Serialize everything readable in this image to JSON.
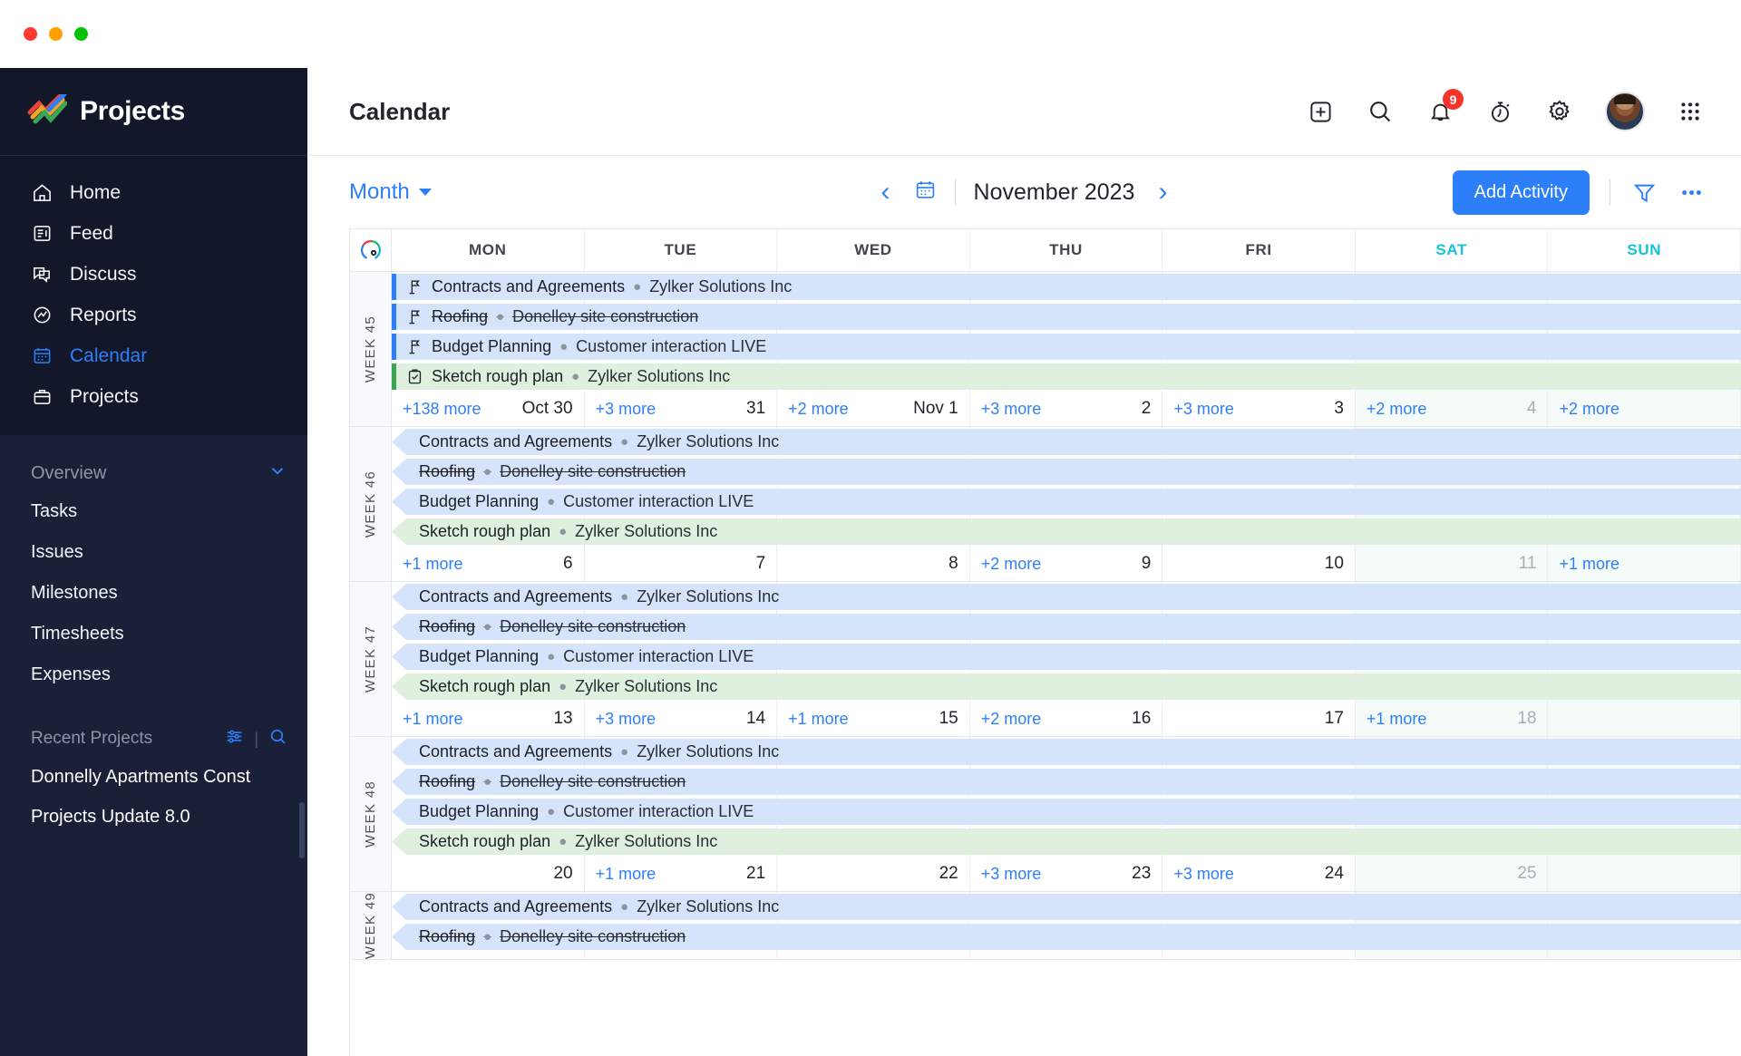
{
  "window": {
    "traffic_lights": [
      "close",
      "minimize",
      "maximize"
    ]
  },
  "sidebar": {
    "brand": "Projects",
    "nav_items": [
      {
        "label": "Home",
        "icon": "home-icon",
        "active": false
      },
      {
        "label": "Feed",
        "icon": "feed-icon",
        "active": false
      },
      {
        "label": "Discuss",
        "icon": "discuss-icon",
        "active": false
      },
      {
        "label": "Reports",
        "icon": "reports-icon",
        "active": false
      },
      {
        "label": "Calendar",
        "icon": "calendar-icon",
        "active": true
      },
      {
        "label": "Projects",
        "icon": "briefcase-icon",
        "active": false
      }
    ],
    "overview_label": "Overview",
    "module_items": [
      {
        "label": "Tasks"
      },
      {
        "label": "Issues"
      },
      {
        "label": "Milestones"
      },
      {
        "label": "Timesheets"
      },
      {
        "label": "Expenses"
      }
    ],
    "recent_label": "Recent Projects",
    "recent_separator": "|",
    "recent_items": [
      {
        "label": "Donnelly Apartments Const"
      },
      {
        "label": "Projects Update 8.0"
      }
    ]
  },
  "header": {
    "page_title": "Calendar",
    "actions": [
      {
        "name": "add-box-icon"
      },
      {
        "name": "search-icon"
      },
      {
        "name": "notifications-icon",
        "badge": "9"
      },
      {
        "name": "timer-icon"
      },
      {
        "name": "settings-icon"
      },
      {
        "name": "avatar"
      },
      {
        "name": "apps-grid-icon"
      }
    ],
    "notification_count": "9"
  },
  "toolbar": {
    "view_label": "Month",
    "prev_label": "‹",
    "next_label": "›",
    "current_period": "November 2023",
    "add_activity_label": "Add Activity",
    "filter_icon": "filter-icon",
    "more_icon": "more-options-icon",
    "datepicker_icon": "calendar-picker-icon"
  },
  "calendar": {
    "corner_icon": "calendar-settings-icon",
    "day_headers": [
      {
        "label": "MON",
        "weekend": false
      },
      {
        "label": "TUE",
        "weekend": false
      },
      {
        "label": "WED",
        "weekend": false
      },
      {
        "label": "THU",
        "weekend": false
      },
      {
        "label": "FRI",
        "weekend": false
      },
      {
        "label": "SAT",
        "weekend": true
      },
      {
        "label": "SUN",
        "weekend": true
      }
    ],
    "weeks": [
      {
        "label": "WEEK 45",
        "events": [
          {
            "title": "Contracts and Agreements",
            "project": "Zylker Solutions Inc",
            "color": "blue",
            "icon": "milestone-flag-icon",
            "start": true,
            "strike": false,
            "span": 7
          },
          {
            "title": "Roofing",
            "project": "Donelley site construction",
            "color": "blue",
            "icon": "milestone-flag-icon",
            "start": true,
            "strike": true,
            "span": 7
          },
          {
            "title": "Budget Planning",
            "project": "Customer interaction LIVE",
            "color": "blue",
            "icon": "milestone-flag-icon",
            "start": true,
            "strike": false,
            "span": 7
          },
          {
            "title": "Sketch rough plan",
            "project": "Zylker Solutions Inc",
            "color": "green",
            "icon": "task-clipboard-icon",
            "start": true,
            "strike": false,
            "span": 7
          }
        ],
        "days": [
          {
            "more": "+138 more",
            "date": "Oct 30",
            "weekend": false
          },
          {
            "more": "+3 more",
            "date": "31",
            "weekend": false
          },
          {
            "more": "+2 more",
            "date": "Nov 1",
            "weekend": false
          },
          {
            "more": "+3 more",
            "date": "2",
            "weekend": false
          },
          {
            "more": "+3 more",
            "date": "3",
            "weekend": false
          },
          {
            "more": "+2 more",
            "date": "4",
            "weekend": true
          },
          {
            "more": "+2 more",
            "date": "",
            "weekend": true
          }
        ]
      },
      {
        "label": "WEEK 46",
        "events": [
          {
            "title": "Contracts and Agreements",
            "project": "Zylker Solutions Inc",
            "color": "blue",
            "icon": "",
            "start": false,
            "strike": false,
            "span": 7
          },
          {
            "title": "Roofing",
            "project": "Donelley site construction",
            "color": "blue",
            "icon": "",
            "start": false,
            "strike": true,
            "span": 7
          },
          {
            "title": "Budget Planning",
            "project": "Customer interaction LIVE",
            "color": "blue",
            "icon": "",
            "start": false,
            "strike": false,
            "span": 7
          },
          {
            "title": "Sketch rough plan",
            "project": "Zylker Solutions Inc",
            "color": "green",
            "icon": "",
            "start": false,
            "strike": false,
            "span": 7
          }
        ],
        "days": [
          {
            "more": "+1 more",
            "date": "6",
            "weekend": false
          },
          {
            "more": "",
            "date": "7",
            "weekend": false
          },
          {
            "more": "",
            "date": "8",
            "weekend": false
          },
          {
            "more": "+2 more",
            "date": "9",
            "weekend": false
          },
          {
            "more": "",
            "date": "10",
            "weekend": false
          },
          {
            "more": "",
            "date": "11",
            "weekend": true
          },
          {
            "more": "+1 more",
            "date": "",
            "weekend": true
          }
        ]
      },
      {
        "label": "WEEK 47",
        "events": [
          {
            "title": "Contracts and Agreements",
            "project": "Zylker Solutions Inc",
            "color": "blue",
            "icon": "",
            "start": false,
            "strike": false,
            "span": 7
          },
          {
            "title": "Roofing",
            "project": "Donelley site construction",
            "color": "blue",
            "icon": "",
            "start": false,
            "strike": true,
            "span": 7
          },
          {
            "title": "Budget Planning",
            "project": "Customer interaction LIVE",
            "color": "blue",
            "icon": "",
            "start": false,
            "strike": false,
            "span": 7
          },
          {
            "title": "Sketch rough plan",
            "project": "Zylker Solutions Inc",
            "color": "green",
            "icon": "",
            "start": false,
            "strike": false,
            "span": 7
          }
        ],
        "days": [
          {
            "more": "+1 more",
            "date": "13",
            "weekend": false
          },
          {
            "more": "+3 more",
            "date": "14",
            "weekend": false
          },
          {
            "more": "+1 more",
            "date": "15",
            "weekend": false
          },
          {
            "more": "+2 more",
            "date": "16",
            "weekend": false
          },
          {
            "more": "",
            "date": "17",
            "weekend": false
          },
          {
            "more": "+1 more",
            "date": "18",
            "weekend": true
          },
          {
            "more": "",
            "date": "",
            "weekend": true
          }
        ]
      },
      {
        "label": "WEEK 48",
        "events": [
          {
            "title": "Contracts and Agreements",
            "project": "Zylker Solutions Inc",
            "color": "blue",
            "icon": "",
            "start": false,
            "strike": false,
            "span": 7
          },
          {
            "title": "Roofing",
            "project": "Donelley site construction",
            "color": "blue",
            "icon": "",
            "start": false,
            "strike": true,
            "span": 7
          },
          {
            "title": "Budget Planning",
            "project": "Customer interaction LIVE",
            "color": "blue",
            "icon": "",
            "start": false,
            "strike": false,
            "span": 7
          },
          {
            "title": "Sketch rough plan",
            "project": "Zylker Solutions Inc",
            "color": "green",
            "icon": "",
            "start": false,
            "strike": false,
            "span": 7
          }
        ],
        "days": [
          {
            "more": "",
            "date": "20",
            "weekend": false
          },
          {
            "more": "+1 more",
            "date": "21",
            "weekend": false
          },
          {
            "more": "",
            "date": "22",
            "weekend": false
          },
          {
            "more": "+3 more",
            "date": "23",
            "weekend": false
          },
          {
            "more": "+3 more",
            "date": "24",
            "weekend": false
          },
          {
            "more": "",
            "date": "25",
            "weekend": true
          },
          {
            "more": "",
            "date": "",
            "weekend": true
          }
        ]
      },
      {
        "label": "WEEK 49",
        "events": [
          {
            "title": "Contracts and Agreements",
            "project": "Zylker Solutions Inc",
            "color": "blue",
            "icon": "",
            "start": false,
            "strike": false,
            "span": 7
          },
          {
            "title": "Roofing",
            "project": "Donelley site construction",
            "color": "blue",
            "icon": "",
            "start": false,
            "strike": true,
            "span": 7
          }
        ],
        "days": []
      }
    ]
  }
}
